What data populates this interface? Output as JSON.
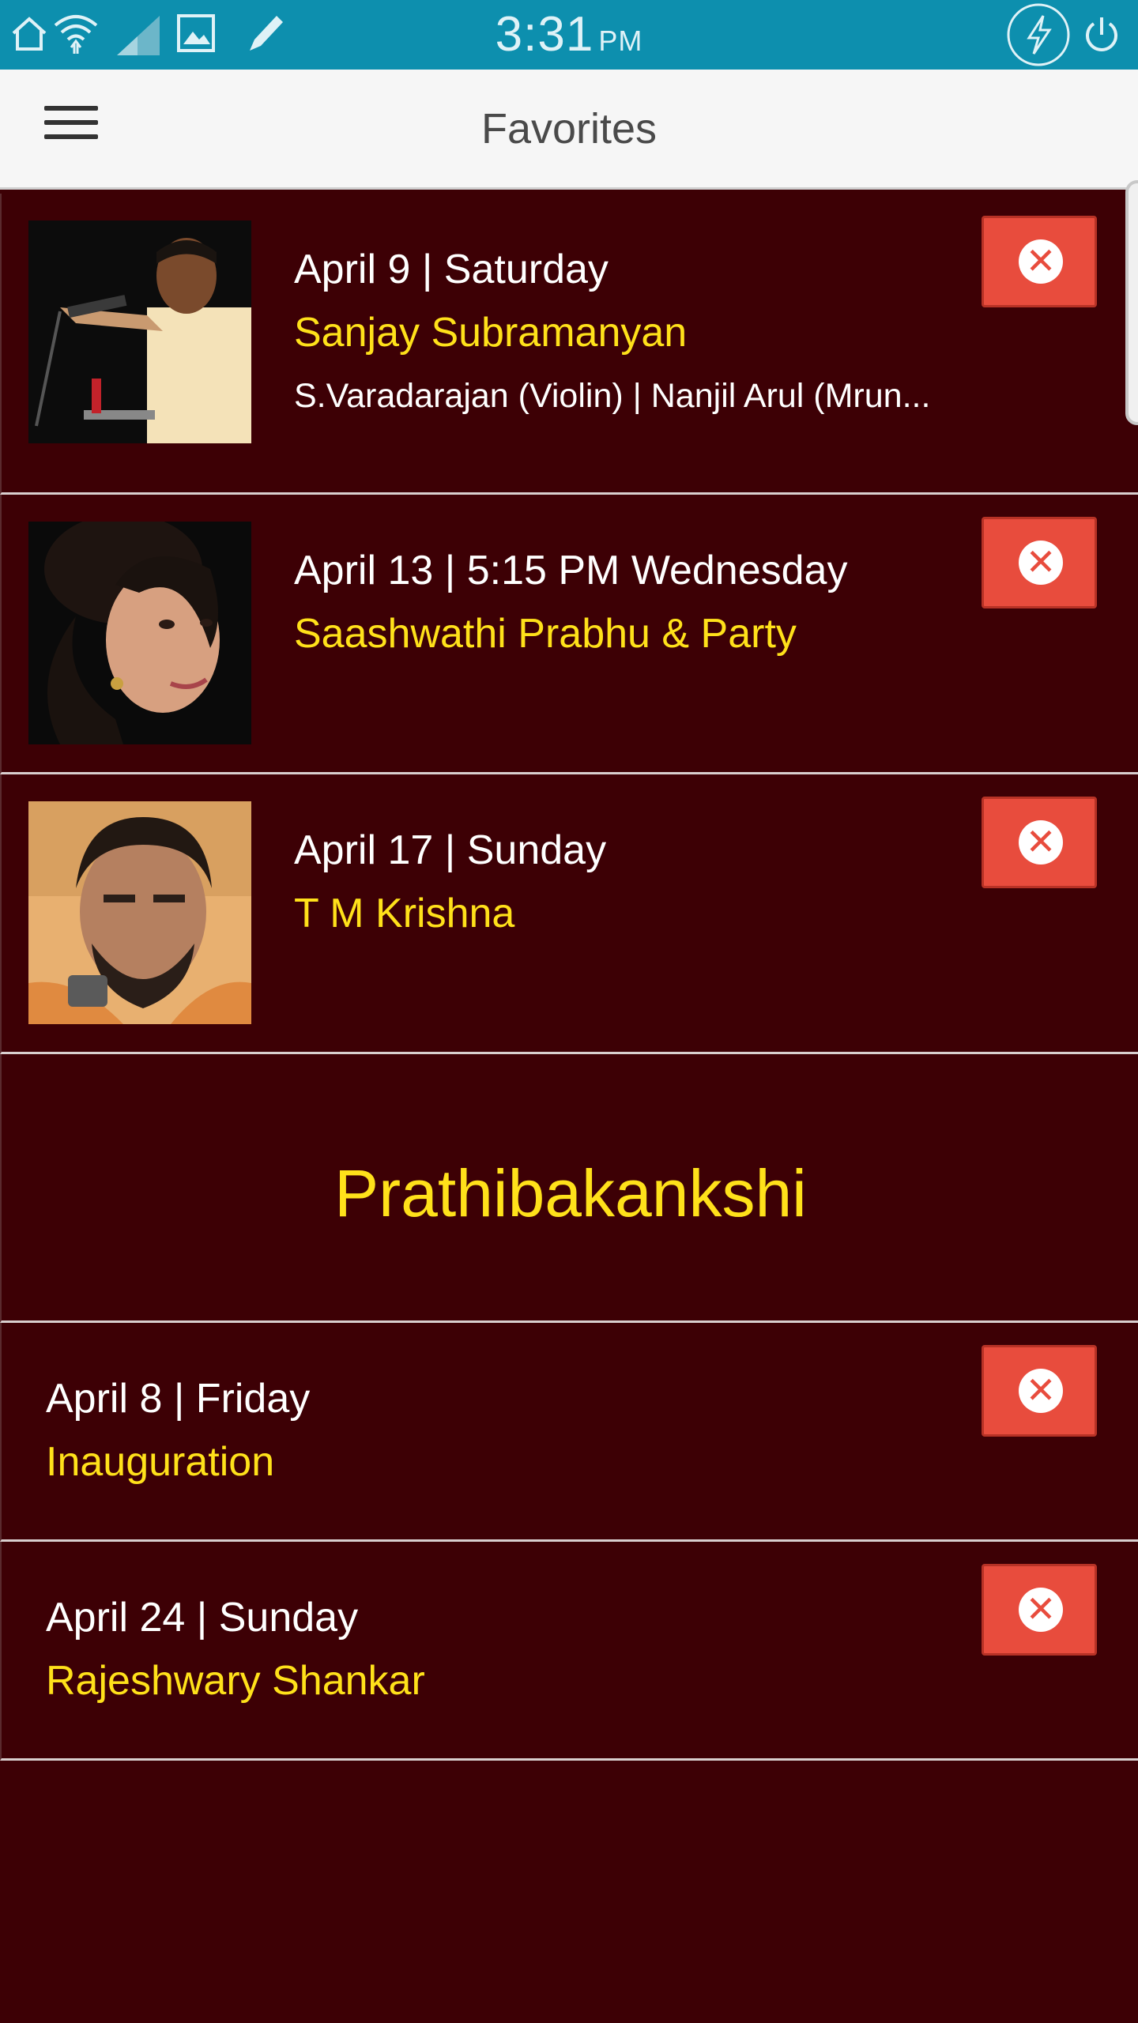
{
  "status_bar": {
    "time": "3:31",
    "ampm": "PM",
    "icons": [
      "home-icon",
      "wifi-icon",
      "signal-icon",
      "gallery-icon",
      "pen-icon",
      "flash-icon",
      "power-icon"
    ]
  },
  "app_bar": {
    "title": "Favorites",
    "menu_icon": "hamburger-menu-icon"
  },
  "favorites": [
    {
      "date": "April 9 | Saturday",
      "name": "Sanjay Subramanyan",
      "accompanists": "S.Varadarajan (Violin) | Nanjil Arul (Mrun...",
      "thumbnail": "singer-with-microphone-photo"
    },
    {
      "date": "April 13 | 5:15 PM Wednesday",
      "name": "Saashwathi Prabhu & Party",
      "accompanists": "",
      "thumbnail": "smiling-woman-portrait-photo"
    },
    {
      "date": "April 17 | Sunday",
      "name": "T M Krishna",
      "accompanists": "",
      "thumbnail": "bearded-man-portrait-photo"
    }
  ],
  "section": {
    "title": "Prathibakankshi"
  },
  "section_items": [
    {
      "date": "April 8 | Friday",
      "name": "Inauguration"
    },
    {
      "date": "April 24 | Sunday",
      "name": "Rajeshwary Shankar"
    }
  ],
  "colors": {
    "background": "#3d0005",
    "status_bar": "#0d8fae",
    "app_bar": "#f6f6f6",
    "name_text": "#ffe11a",
    "date_text": "#ffffff",
    "remove_button": "#e84c3d"
  },
  "remove_icon": "close-circle-icon"
}
